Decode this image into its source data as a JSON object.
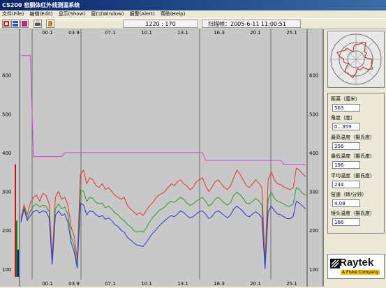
{
  "window": {
    "title": "CS200 窑胴体红外线测温系统"
  },
  "menu": {
    "items": [
      "文件(File)",
      "编辑(Edit)",
      "显示(Show)",
      "窗口(Window)",
      "报警(Alert)",
      "帮助(Help)"
    ]
  },
  "toolbar": {
    "position_readout": "1220 : 170",
    "scan_frame_label": "扫描帧：",
    "scan_frame_time": "2005-6-11 11:00:51"
  },
  "chart_data": {
    "type": "line",
    "x_tick_labels": [
      "00.1",
      "03.9",
      "07.1",
      "10.1",
      "13.1",
      "16.3",
      "20.1",
      "25.1"
    ],
    "ylim": [
      80,
      700
    ],
    "y_ticks": [
      100,
      200,
      300,
      400,
      500,
      600
    ],
    "colors": {
      "max": "#e83030",
      "avg": "#2a9a2a",
      "min": "#3030e0",
      "limit": "#e040e0",
      "bar_red": "#d01010",
      "bar_green": "#108010",
      "bar_blue": "#1010c0",
      "background": "#c8c8c8",
      "divider": "#6a6a6a"
    },
    "series": [
      {
        "key": "max",
        "values": [
          230,
          265,
          240,
          270,
          285,
          290,
          275,
          295,
          290,
          268,
          130,
          285,
          300,
          280,
          285,
          265,
          210,
          185,
          125,
          345,
          355,
          320,
          335,
          330,
          315,
          310,
          320,
          305,
          310,
          300,
          290,
          285,
          280,
          285,
          265,
          255,
          248,
          240,
          245,
          238,
          250,
          262,
          270,
          282,
          290,
          295,
          300,
          310,
          320,
          315,
          325,
          330,
          320,
          315,
          305,
          310,
          325,
          330,
          335,
          315,
          300,
          310,
          325,
          330,
          320,
          310,
          305,
          315,
          335,
          355,
          345,
          330,
          315,
          310,
          320,
          330,
          322,
          310,
          120,
          330,
          350,
          330,
          320,
          318,
          312,
          308,
          305,
          310,
          360,
          355,
          345,
          338
        ]
      },
      {
        "key": "avg",
        "values": [
          225,
          260,
          230,
          250,
          262,
          268,
          260,
          265,
          262,
          248,
          118,
          255,
          268,
          255,
          260,
          240,
          185,
          160,
          110,
          305,
          300,
          275,
          285,
          282,
          272,
          268,
          270,
          258,
          262,
          255,
          245,
          240,
          230,
          225,
          215,
          210,
          200,
          195,
          198,
          195,
          205,
          220,
          232,
          240,
          250,
          255,
          260,
          270,
          275,
          272,
          278,
          285,
          280,
          270,
          265,
          268,
          275,
          280,
          285,
          275,
          262,
          268,
          280,
          285,
          278,
          270,
          265,
          272,
          290,
          298,
          292,
          282,
          270,
          268,
          275,
          282,
          276,
          265,
          108,
          280,
          298,
          282,
          275,
          272,
          268,
          262,
          262,
          268,
          310,
          305,
          295,
          290
        ]
      },
      {
        "key": "min",
        "values": [
          220,
          255,
          225,
          238,
          248,
          252,
          245,
          250,
          248,
          232,
          112,
          238,
          250,
          238,
          242,
          220,
          170,
          145,
          102,
          270,
          265,
          240,
          250,
          248,
          240,
          235,
          238,
          228,
          232,
          225,
          215,
          210,
          200,
          195,
          182,
          175,
          168,
          162,
          160,
          158,
          168,
          180,
          192,
          200,
          210,
          218,
          225,
          232,
          238,
          235,
          242,
          250,
          246,
          238,
          232,
          235,
          242,
          248,
          250,
          242,
          230,
          235,
          246,
          250,
          245,
          238,
          232,
          240,
          255,
          262,
          256,
          248,
          238,
          235,
          242,
          248,
          242,
          232,
          100,
          248,
          262,
          250,
          242,
          240,
          235,
          230,
          230,
          236,
          275,
          270,
          262,
          255
        ]
      },
      {
        "key": "limit",
        "values": [
          650,
          650,
          650,
          650,
          390,
          390,
          390,
          390,
          390,
          390,
          390,
          390,
          390,
          390,
          400,
          400,
          400,
          400,
          400,
          400,
          400,
          400,
          400,
          400,
          400,
          400,
          400,
          400,
          400,
          400,
          400,
          400,
          400,
          400,
          400,
          400,
          400,
          400,
          400,
          400,
          400,
          400,
          400,
          400,
          400,
          400,
          400,
          400,
          400,
          400,
          400,
          400,
          400,
          400,
          400,
          400,
          400,
          400,
          400,
          380,
          380,
          380,
          380,
          380,
          380,
          380,
          380,
          380,
          380,
          380,
          380,
          380,
          380,
          380,
          380,
          380,
          380,
          380,
          380,
          380,
          380,
          380,
          380,
          380,
          370,
          370,
          370,
          370,
          370,
          370,
          370,
          370
        ]
      }
    ],
    "side_bars": [
      {
        "key": "bar_red",
        "value": 370
      },
      {
        "key": "bar_green",
        "value": 225
      },
      {
        "key": "bar_blue",
        "value": 150
      }
    ]
  },
  "radar": {
    "rings": 3
  },
  "readouts": [
    {
      "label": "距离（厘米）",
      "value": "563"
    },
    {
      "label": "角度（度）",
      "value": "0...359"
    },
    {
      "label": "最高温度（摄氏度）",
      "value": "356"
    },
    {
      "label": "最低温度（摄氏度）",
      "value": "196"
    },
    {
      "label": "平均温度（摄氏度）",
      "value": "244"
    },
    {
      "label": "窑速（转/分钟）",
      "value": "4.08"
    },
    {
      "label": "镜头温度（摄氏度）",
      "value": "166"
    }
  ],
  "logo": {
    "name": "Raytek",
    "tagline": "A Fluke Company"
  }
}
